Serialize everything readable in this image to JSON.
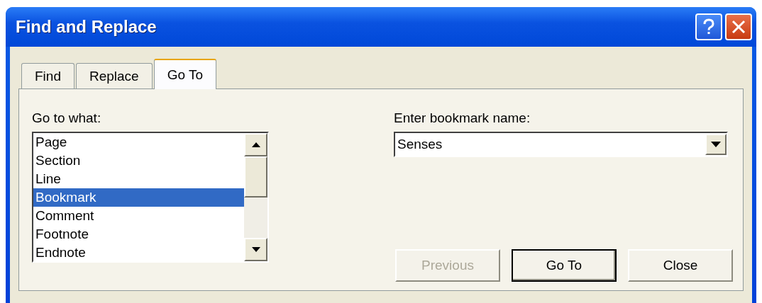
{
  "window": {
    "title": "Find and Replace"
  },
  "tabs": [
    {
      "label": "Find",
      "selected": false
    },
    {
      "label": "Replace",
      "selected": false
    },
    {
      "label": "Go To",
      "selected": true
    }
  ],
  "go_to_what": {
    "label": "Go to what:",
    "items": [
      {
        "label": "Page",
        "selected": false
      },
      {
        "label": "Section",
        "selected": false
      },
      {
        "label": "Line",
        "selected": false
      },
      {
        "label": "Bookmark",
        "selected": true
      },
      {
        "label": "Comment",
        "selected": false
      },
      {
        "label": "Footnote",
        "selected": false
      },
      {
        "label": "Endnote",
        "selected": false
      }
    ]
  },
  "bookmark": {
    "label": "Enter bookmark name:",
    "value": "Senses"
  },
  "buttons": [
    {
      "label": "Previous",
      "disabled": true,
      "default": false
    },
    {
      "label": "Go To",
      "disabled": false,
      "default": true
    },
    {
      "label": "Close",
      "disabled": false,
      "default": false
    }
  ]
}
